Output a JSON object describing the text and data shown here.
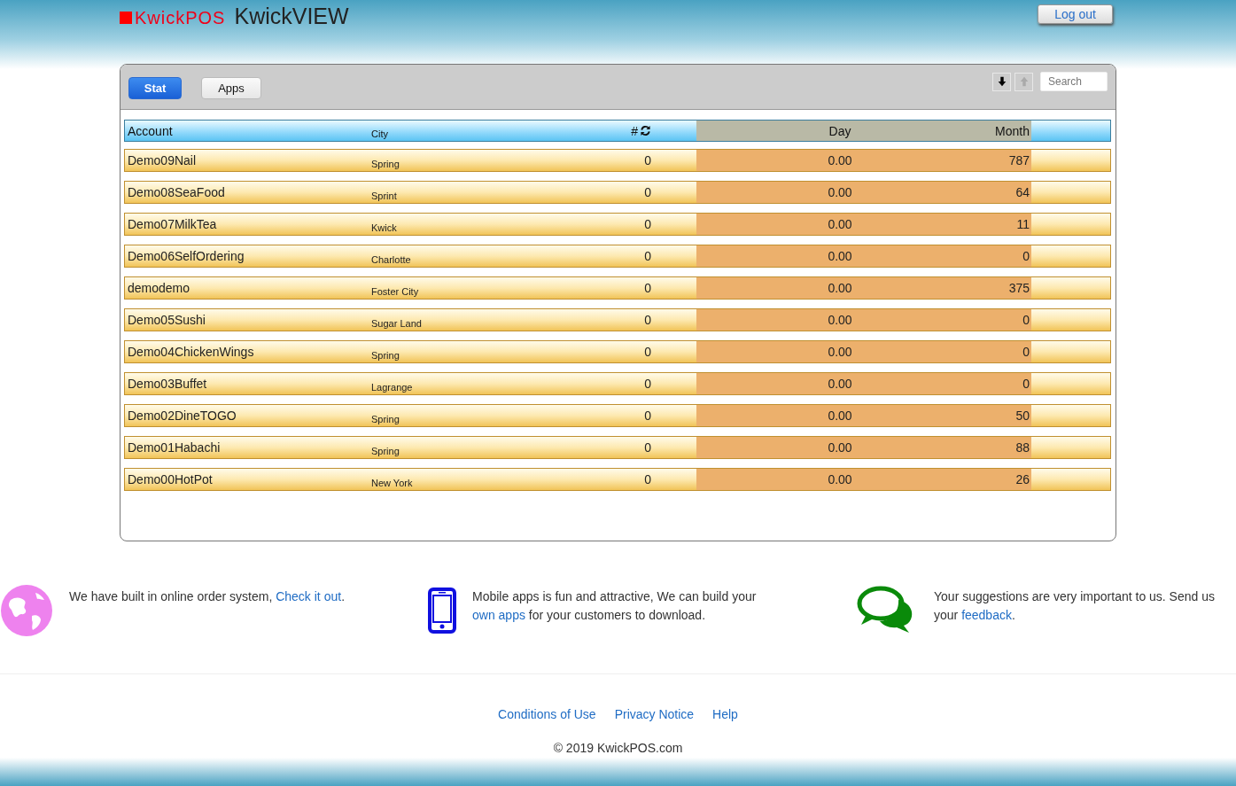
{
  "header": {
    "logo": "KwickPOS",
    "title": "KwickVIEW",
    "logout": "Log out"
  },
  "tabs": [
    {
      "label": "Stat",
      "selected": true
    },
    {
      "label": "Apps",
      "selected": false
    }
  ],
  "sort": [
    {
      "kind": "down",
      "disabled": false
    },
    {
      "kind": "up",
      "disabled": true
    }
  ],
  "search": {
    "placeholder": "Search"
  },
  "table": {
    "columns": [
      "Account",
      "City",
      "#",
      "Day",
      "Month"
    ],
    "rows": [
      [
        "Demo09Nail",
        "Spring",
        "0",
        "0.00",
        "787"
      ],
      [
        "Demo08SeaFood",
        "Sprint",
        "0",
        "0.00",
        "64"
      ],
      [
        "Demo07MilkTea",
        "Kwick",
        "0",
        "0.00",
        "11"
      ],
      [
        "Demo06SelfOrdering",
        "Charlotte",
        "0",
        "0.00",
        "0"
      ],
      [
        "demodemo",
        "Foster City",
        "0",
        "0.00",
        "375"
      ],
      [
        "Demo05Sushi",
        "Sugar Land",
        "0",
        "0.00",
        "0"
      ],
      [
        "Demo04ChickenWings",
        "Spring",
        "0",
        "0.00",
        "0"
      ],
      [
        "Demo03Buffet",
        "Lagrange",
        "0",
        "0.00",
        "0"
      ],
      [
        "Demo02DineTOGO",
        "Spring",
        "0",
        "0.00",
        "50"
      ],
      [
        "Demo01Habachi",
        "Spring",
        "0",
        "0.00",
        "88"
      ],
      [
        "Demo00HotPot",
        "New York",
        "0",
        "0.00",
        "26"
      ]
    ]
  },
  "promos": [
    {
      "kind": "globe",
      "before": "We have built in online order system, ",
      "link": "Check it out",
      "after": "."
    },
    {
      "kind": "phone",
      "before": "Mobile apps is fun and attractive, We can build your ",
      "link": "own apps",
      "after": " for your customers to download."
    },
    {
      "kind": "chat",
      "before": "Your suggestions are very important to us. Send us your ",
      "link": "feedback",
      "after": "."
    }
  ],
  "footer_links": [
    "Conditions of Use",
    "Privacy Notice",
    "Help"
  ],
  "copyright": "© 2019 KwickPOS.com"
}
